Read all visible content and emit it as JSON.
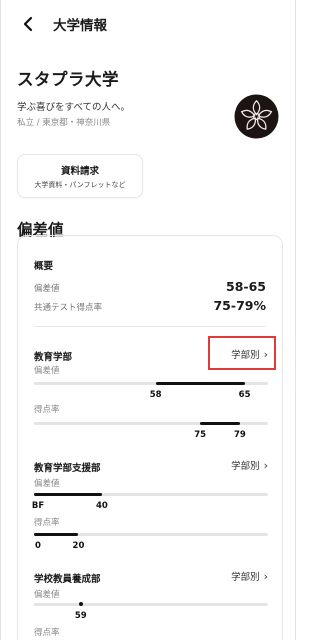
{
  "topbar": {
    "title": "大学情報",
    "back_icon": "chevron-left-icon"
  },
  "university": {
    "name": "スタプラ大学",
    "tagline": "学ぶ喜びをすべての人へ。",
    "meta": "私立 / 東京都・神奈川県",
    "crest_icon": "cherry-blossom-crest-icon",
    "crest_color": "#1c1412"
  },
  "doc_request": {
    "title": "資料請求",
    "subtitle": "大学資料・パンフレットなど"
  },
  "hensachi": {
    "section_title": "偏差値",
    "summary": {
      "title": "概要",
      "rows": [
        {
          "label": "偏差値",
          "value": "58-65"
        },
        {
          "label": "共通テスト得点率",
          "value": "75-79%"
        }
      ]
    },
    "departments": [
      {
        "name": "教育学部",
        "link_label": "学部別",
        "highlighted": true,
        "metrics": [
          {
            "label": "偏差値",
            "min_label": "58",
            "max_label": "65",
            "min_frac": 0.52,
            "max_frac": 0.9
          },
          {
            "label": "得点率",
            "min_label": "75",
            "max_label": "79",
            "min_frac": 0.71,
            "max_frac": 0.88
          }
        ]
      },
      {
        "name": "教育学部支援部",
        "link_label": "学部別",
        "highlighted": false,
        "metrics": [
          {
            "label": "偏差値",
            "min_label": "BF",
            "max_label": "40",
            "min_frac": 0.0,
            "max_frac": 0.29
          },
          {
            "label": "得点率",
            "min_label": "0",
            "max_label": "20",
            "min_frac": 0.0,
            "max_frac": 0.19
          }
        ]
      },
      {
        "name": "学校教員養成部",
        "link_label": "学部別",
        "highlighted": false,
        "metrics": [
          {
            "label": "偏差値",
            "min_label": "59",
            "max_label": "59",
            "min_frac": 0.2,
            "max_frac": 0.2
          },
          {
            "label": "得点率",
            "min_label": "",
            "max_label": "",
            "min_frac": 0,
            "max_frac": 0
          }
        ]
      }
    ],
    "highlight_color": "#e03a3a"
  }
}
